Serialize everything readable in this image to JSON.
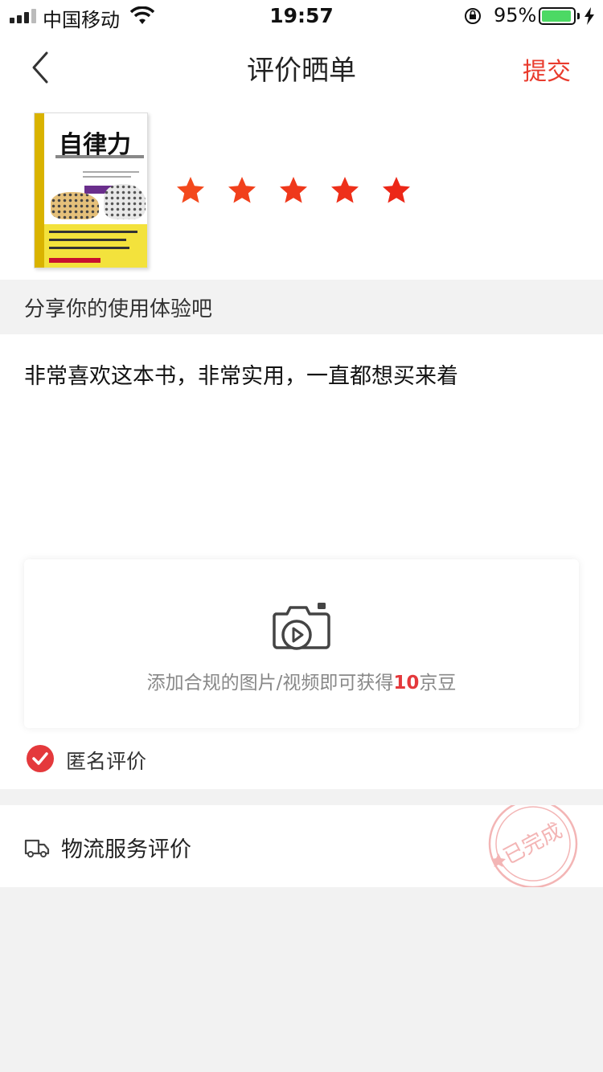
{
  "status_bar": {
    "carrier": "中国移动",
    "time": "19:57",
    "battery_percent": "95%",
    "battery_level": 0.95,
    "icons": [
      "signal-icon",
      "wifi-icon",
      "orientation-lock-icon",
      "battery-icon",
      "charging-bolt-icon"
    ]
  },
  "nav": {
    "title": "评价晒单",
    "submit_label": "提交",
    "back_icon": "chevron-left-icon"
  },
  "product": {
    "cover": {
      "title": "自律力"
    },
    "rating_stars": 5,
    "star_color": "#f0301a"
  },
  "share": {
    "prompt": "分享你的使用体验吧"
  },
  "review": {
    "text": "非常喜欢这本书，非常实用，一直都想买来着"
  },
  "upload": {
    "icon": "camera-video-icon",
    "text_before": "添加合规的图片/视频即可获得",
    "reward_amount": "10",
    "text_after": "京豆"
  },
  "anonymous": {
    "label": "匿名评价",
    "checked": true,
    "color": "#e4393c"
  },
  "logistics": {
    "label": "物流服务评价",
    "icon": "truck-icon",
    "stamp_text": "已完成",
    "stamp_color": "#f3b5b5"
  },
  "colors": {
    "accent": "#e93b2d",
    "background": "#f2f2f2"
  }
}
